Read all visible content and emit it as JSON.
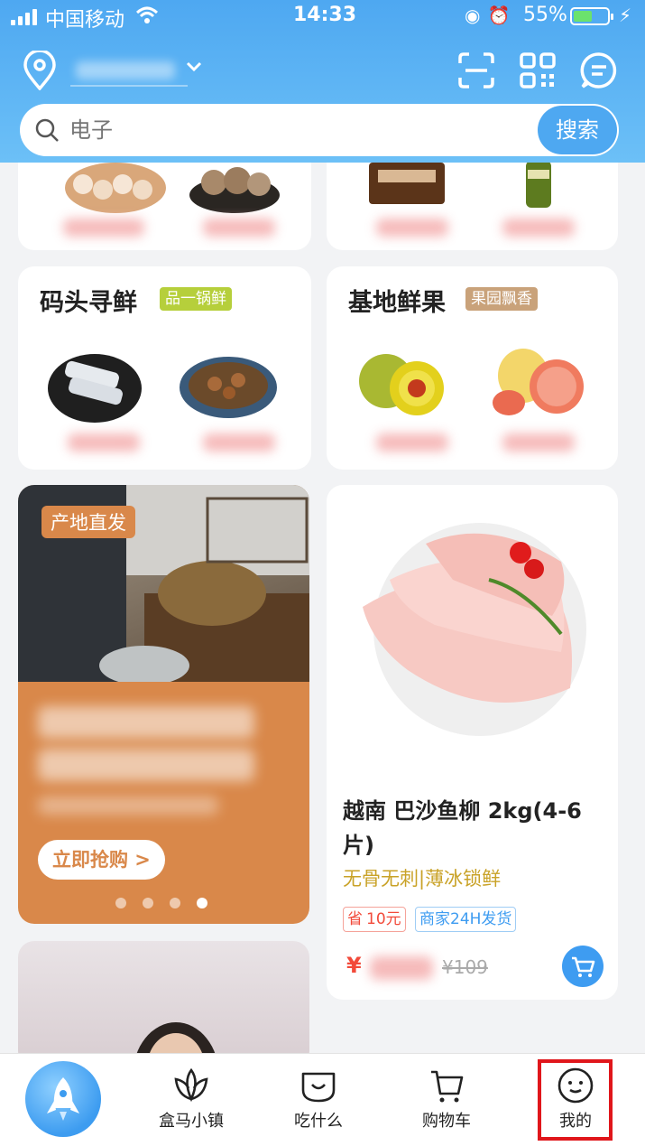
{
  "status_bar": {
    "carrier": "中国移动",
    "time": "14:33",
    "battery_percent_text": "55%",
    "battery_level": 0.55
  },
  "header": {
    "search_placeholder": "电子",
    "search_button": "搜索"
  },
  "categories": [
    {
      "title": "码头寻鲜",
      "tag": "品一锅鲜",
      "tag_color": "#b6cf3b"
    },
    {
      "title": "基地鲜果",
      "tag": "果园飘香",
      "tag_color": "#c9a27a"
    }
  ],
  "promo": {
    "tag": "产地直发",
    "button": "立即抢购 >",
    "slides": 4,
    "active_slide": 4
  },
  "product": {
    "name": "越南 巴沙鱼柳 2kg(4-6片)",
    "subtitle": "无骨无刺|薄冰锁鲜",
    "badge_save_label": "省",
    "badge_save_value": "10元",
    "badge_ship": "商家24H发货",
    "price_symbol": "¥",
    "original_price": "¥109"
  },
  "tabbar": {
    "items": [
      {
        "label": "盒马小镇"
      },
      {
        "label": "吃什么"
      },
      {
        "label": "购物车"
      },
      {
        "label": "我的"
      }
    ]
  },
  "colors": {
    "brand_blue": "#4ea8f1",
    "price_red": "#f24a3a",
    "promo_orange": "#d9884a",
    "highlight_red": "#e0161b"
  }
}
